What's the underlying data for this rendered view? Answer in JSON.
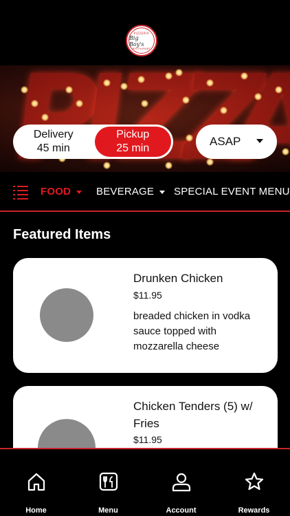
{
  "brand": {
    "logo_top": "PIZZERIA",
    "logo_main": "Big Boy's",
    "logo_bottom": "RESTAURANT"
  },
  "order_mode": {
    "delivery": {
      "label": "Delivery",
      "time": "45 min"
    },
    "pickup": {
      "label": "Pickup",
      "time": "25 min",
      "selected": true
    }
  },
  "timing": {
    "value": "ASAP"
  },
  "categories": [
    {
      "label": "FOOD",
      "active": true
    },
    {
      "label": "BEVERAGE",
      "active": false
    },
    {
      "label": "SPECIAL EVENT MENU",
      "active": false
    }
  ],
  "featured": {
    "title": "Featured Items",
    "items": [
      {
        "name": "Drunken Chicken",
        "price": "$11.95",
        "description": "breaded chicken in vodka sauce topped with mozzarella cheese"
      },
      {
        "name": "Chicken Tenders (5) w/ Fries",
        "price": "$11.95",
        "description": ""
      }
    ]
  },
  "bottom_nav": [
    {
      "label": "Home",
      "icon": "home-icon"
    },
    {
      "label": "Menu",
      "icon": "menu-utensils-icon"
    },
    {
      "label": "Account",
      "icon": "account-icon"
    },
    {
      "label": "Rewards",
      "icon": "star-icon"
    }
  ],
  "colors": {
    "accent": "#e1191f",
    "background": "#000000",
    "card": "#ffffff",
    "placeholder": "#8a8a8a"
  }
}
